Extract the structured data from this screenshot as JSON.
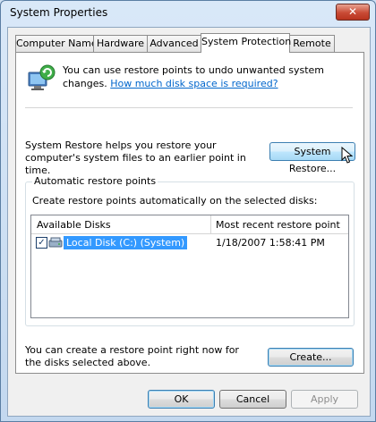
{
  "window": {
    "title": "System Properties",
    "close_glyph": "✕"
  },
  "tabs": [
    {
      "label": "Computer Name",
      "active": false
    },
    {
      "label": "Hardware",
      "active": false
    },
    {
      "label": "Advanced",
      "active": false
    },
    {
      "label": "System Protection",
      "active": true
    },
    {
      "label": "Remote",
      "active": false
    }
  ],
  "protection": {
    "intro": "You can use restore points to undo unwanted system changes.",
    "intro_link": "How much disk space is required?",
    "restore_text": "System Restore helps you restore your computer's system files to an earlier point in time.",
    "restore_button": "System Restore...",
    "group_title": "Automatic restore points",
    "group_desc": "Create restore points automatically on the selected disks:",
    "columns": [
      "Available Disks",
      "Most recent restore point"
    ],
    "disks": [
      {
        "name": "Local Disk (C:) (System)",
        "checked": true,
        "check_glyph": "✓",
        "recent": "1/18/2007 1:58:41 PM"
      }
    ],
    "create_text": "You can create a restore point right now for the disks selected above.",
    "create_button": "Create..."
  },
  "footer": {
    "ok": "OK",
    "cancel": "Cancel",
    "apply": "Apply"
  },
  "icons": [
    "restore-shield-icon",
    "disk-drive-icon",
    "mouse-cursor-icon",
    "close-icon"
  ]
}
